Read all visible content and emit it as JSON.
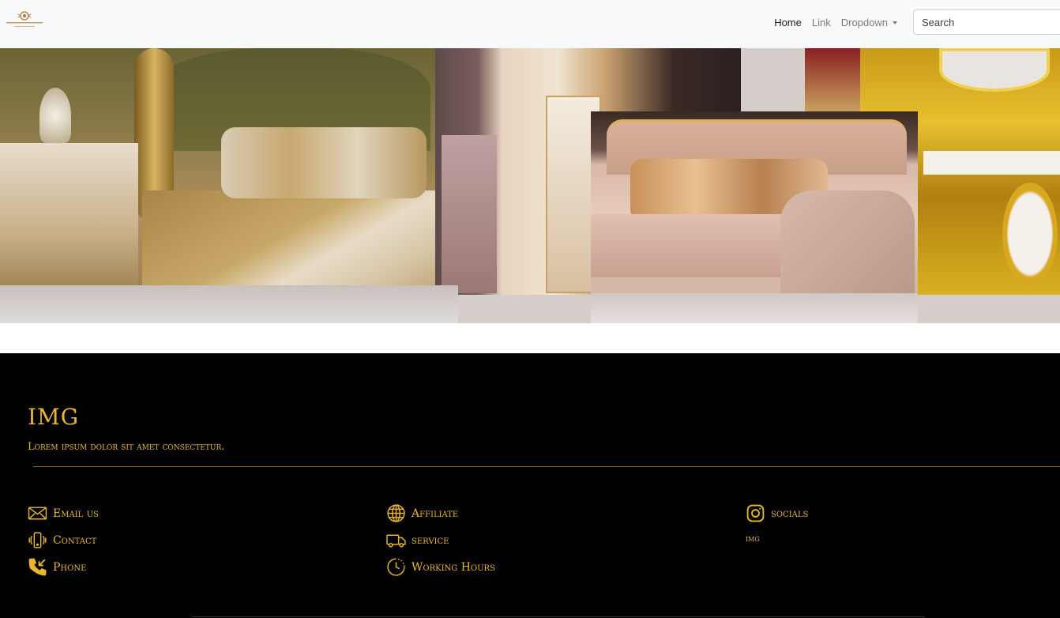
{
  "navbar": {
    "links": [
      {
        "label": "Home"
      },
      {
        "label": "Link"
      },
      {
        "label": "Dropdown"
      }
    ],
    "search": {
      "placeholder": "Search"
    }
  },
  "footer": {
    "title": "IMG",
    "subtitle": "Lorem ipsum dolor sit amet consectetur.",
    "col1": [
      {
        "label": "Email us",
        "icon": "envelope-icon"
      },
      {
        "label": "Contact",
        "icon": "phone-vibrate-icon"
      },
      {
        "label": "Phone",
        "icon": "phone-incoming-icon"
      }
    ],
    "col2": [
      {
        "label": "Affiliate",
        "icon": "globe-icon"
      },
      {
        "label": "service",
        "icon": "truck-icon"
      },
      {
        "label": "Working Hours",
        "icon": "clock-icon"
      }
    ],
    "col3": {
      "label": "socials",
      "icon": "instagram-icon",
      "handle": "img"
    },
    "accent_color": "#e8b82c"
  }
}
